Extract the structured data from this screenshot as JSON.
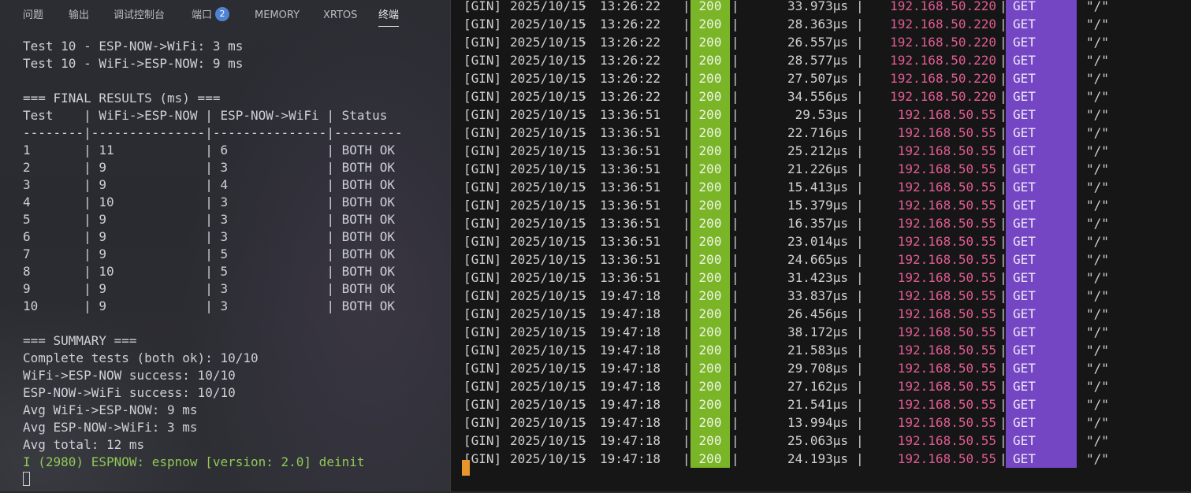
{
  "tabs": [
    {
      "label": "问题"
    },
    {
      "label": "输出"
    },
    {
      "label": "调试控制台"
    },
    {
      "label": "端口",
      "badge": "2"
    },
    {
      "label": "MEMORY"
    },
    {
      "label": "XRTOS"
    },
    {
      "label": "终端",
      "active": true
    }
  ],
  "left_terminal": {
    "lines": [
      "Test 10 - ESP-NOW->WiFi: 3 ms",
      "Test 10 - WiFi->ESP-NOW: 9 ms",
      "",
      "=== FINAL RESULTS (ms) ===",
      "Test    | WiFi->ESP-NOW | ESP-NOW->WiFi | Status",
      "--------|---------------|---------------|---------",
      "1       | 11            | 6             | BOTH OK",
      "2       | 9             | 3             | BOTH OK",
      "3       | 9             | 4             | BOTH OK",
      "4       | 10            | 3             | BOTH OK",
      "5       | 9             | 3             | BOTH OK",
      "6       | 9             | 3             | BOTH OK",
      "7       | 9             | 5             | BOTH OK",
      "8       | 10            | 5             | BOTH OK",
      "9       | 9             | 3             | BOTH OK",
      "10      | 9             | 3             | BOTH OK",
      "",
      "=== SUMMARY ===",
      "Complete tests (both ok): 10/10",
      "WiFi->ESP-NOW success: 10/10",
      "ESP-NOW->WiFi success: 10/10",
      "Avg WiFi->ESP-NOW: 9 ms",
      "Avg ESP-NOW->WiFi: 3 ms",
      "Avg total: 12 ms"
    ],
    "deinit_line": "I (2980) ESPNOW: espnow [version: 2.0] deinit"
  },
  "right_terminal": {
    "rows": [
      {
        "prefix": "[GIN]",
        "date": "2025/10/15",
        "time": "13:26:22",
        "status": "200",
        "latency": "33.973µs",
        "ip": "192.168.50.220",
        "method": "GET",
        "path": "\"/\""
      },
      {
        "prefix": "[GIN]",
        "date": "2025/10/15",
        "time": "13:26:22",
        "status": "200",
        "latency": "28.363µs",
        "ip": "192.168.50.220",
        "method": "GET",
        "path": "\"/\""
      },
      {
        "prefix": "[GIN]",
        "date": "2025/10/15",
        "time": "13:26:22",
        "status": "200",
        "latency": "26.557µs",
        "ip": "192.168.50.220",
        "method": "GET",
        "path": "\"/\""
      },
      {
        "prefix": "[GIN]",
        "date": "2025/10/15",
        "time": "13:26:22",
        "status": "200",
        "latency": "28.577µs",
        "ip": "192.168.50.220",
        "method": "GET",
        "path": "\"/\""
      },
      {
        "prefix": "[GIN]",
        "date": "2025/10/15",
        "time": "13:26:22",
        "status": "200",
        "latency": "27.507µs",
        "ip": "192.168.50.220",
        "method": "GET",
        "path": "\"/\""
      },
      {
        "prefix": "[GIN]",
        "date": "2025/10/15",
        "time": "13:26:22",
        "status": "200",
        "latency": "34.556µs",
        "ip": "192.168.50.220",
        "method": "GET",
        "path": "\"/\""
      },
      {
        "prefix": "[GIN]",
        "date": "2025/10/15",
        "time": "13:36:51",
        "status": "200",
        "latency": "29.53µs",
        "ip": "192.168.50.55",
        "method": "GET",
        "path": "\"/\""
      },
      {
        "prefix": "[GIN]",
        "date": "2025/10/15",
        "time": "13:36:51",
        "status": "200",
        "latency": "22.716µs",
        "ip": "192.168.50.55",
        "method": "GET",
        "path": "\"/\""
      },
      {
        "prefix": "[GIN]",
        "date": "2025/10/15",
        "time": "13:36:51",
        "status": "200",
        "latency": "25.212µs",
        "ip": "192.168.50.55",
        "method": "GET",
        "path": "\"/\""
      },
      {
        "prefix": "[GIN]",
        "date": "2025/10/15",
        "time": "13:36:51",
        "status": "200",
        "latency": "21.226µs",
        "ip": "192.168.50.55",
        "method": "GET",
        "path": "\"/\""
      },
      {
        "prefix": "[GIN]",
        "date": "2025/10/15",
        "time": "13:36:51",
        "status": "200",
        "latency": "15.413µs",
        "ip": "192.168.50.55",
        "method": "GET",
        "path": "\"/\""
      },
      {
        "prefix": "[GIN]",
        "date": "2025/10/15",
        "time": "13:36:51",
        "status": "200",
        "latency": "15.379µs",
        "ip": "192.168.50.55",
        "method": "GET",
        "path": "\"/\""
      },
      {
        "prefix": "[GIN]",
        "date": "2025/10/15",
        "time": "13:36:51",
        "status": "200",
        "latency": "16.357µs",
        "ip": "192.168.50.55",
        "method": "GET",
        "path": "\"/\""
      },
      {
        "prefix": "[GIN]",
        "date": "2025/10/15",
        "time": "13:36:51",
        "status": "200",
        "latency": "23.014µs",
        "ip": "192.168.50.55",
        "method": "GET",
        "path": "\"/\""
      },
      {
        "prefix": "[GIN]",
        "date": "2025/10/15",
        "time": "13:36:51",
        "status": "200",
        "latency": "24.665µs",
        "ip": "192.168.50.55",
        "method": "GET",
        "path": "\"/\""
      },
      {
        "prefix": "[GIN]",
        "date": "2025/10/15",
        "time": "13:36:51",
        "status": "200",
        "latency": "31.423µs",
        "ip": "192.168.50.55",
        "method": "GET",
        "path": "\"/\""
      },
      {
        "prefix": "[GIN]",
        "date": "2025/10/15",
        "time": "19:47:18",
        "status": "200",
        "latency": "33.837µs",
        "ip": "192.168.50.55",
        "method": "GET",
        "path": "\"/\""
      },
      {
        "prefix": "[GIN]",
        "date": "2025/10/15",
        "time": "19:47:18",
        "status": "200",
        "latency": "26.456µs",
        "ip": "192.168.50.55",
        "method": "GET",
        "path": "\"/\""
      },
      {
        "prefix": "[GIN]",
        "date": "2025/10/15",
        "time": "19:47:18",
        "status": "200",
        "latency": "38.172µs",
        "ip": "192.168.50.55",
        "method": "GET",
        "path": "\"/\""
      },
      {
        "prefix": "[GIN]",
        "date": "2025/10/15",
        "time": "19:47:18",
        "status": "200",
        "latency": "21.583µs",
        "ip": "192.168.50.55",
        "method": "GET",
        "path": "\"/\""
      },
      {
        "prefix": "[GIN]",
        "date": "2025/10/15",
        "time": "19:47:18",
        "status": "200",
        "latency": "29.708µs",
        "ip": "192.168.50.55",
        "method": "GET",
        "path": "\"/\""
      },
      {
        "prefix": "[GIN]",
        "date": "2025/10/15",
        "time": "19:47:18",
        "status": "200",
        "latency": "27.162µs",
        "ip": "192.168.50.55",
        "method": "GET",
        "path": "\"/\""
      },
      {
        "prefix": "[GIN]",
        "date": "2025/10/15",
        "time": "19:47:18",
        "status": "200",
        "latency": "21.541µs",
        "ip": "192.168.50.55",
        "method": "GET",
        "path": "\"/\""
      },
      {
        "prefix": "[GIN]",
        "date": "2025/10/15",
        "time": "19:47:18",
        "status": "200",
        "latency": "13.994µs",
        "ip": "192.168.50.55",
        "method": "GET",
        "path": "\"/\""
      },
      {
        "prefix": "[GIN]",
        "date": "2025/10/15",
        "time": "19:47:18",
        "status": "200",
        "latency": "25.063µs",
        "ip": "192.168.50.55",
        "method": "GET",
        "path": "\"/\""
      },
      {
        "prefix": "[GIN]",
        "date": "2025/10/15",
        "time": "19:47:18",
        "status": "200",
        "latency": "24.193µs",
        "ip": "192.168.50.55",
        "method": "GET",
        "path": "\"/\""
      }
    ]
  },
  "colors": {
    "status_bg": "#7ab528",
    "method_bg": "#7446c3",
    "ip_text": "#e05c93",
    "cursor": "#e8962a",
    "badge": "#4f83d1"
  }
}
